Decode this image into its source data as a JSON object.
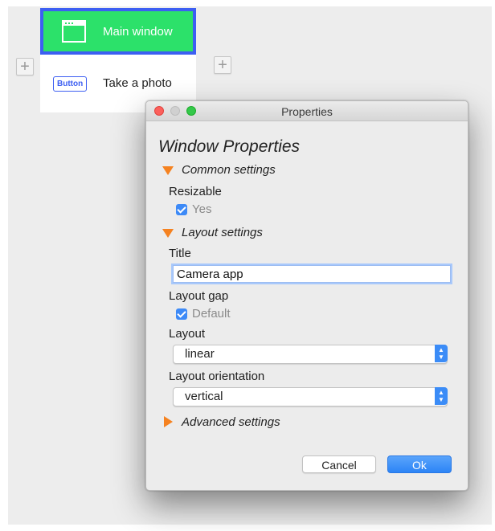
{
  "tree": {
    "main_window_label": "Main window",
    "button_badge": "Button",
    "button_label": "Take a photo",
    "add_icon": "+"
  },
  "dialog": {
    "title": "Properties",
    "heading": "Window Properties",
    "common_settings": {
      "label": "Common settings",
      "resizable_label": "Resizable",
      "resizable_checked": true,
      "resizable_option": "Yes"
    },
    "layout_settings": {
      "label": "Layout settings",
      "title_label": "Title",
      "title_value": "Camera app",
      "layout_gap_label": "Layout gap",
      "layout_gap_checked": true,
      "layout_gap_option": "Default",
      "layout_label": "Layout",
      "layout_value": "linear",
      "orientation_label": "Layout orientation",
      "orientation_value": "vertical"
    },
    "advanced_settings": {
      "label": "Advanced settings"
    },
    "buttons": {
      "cancel": "Cancel",
      "ok": "Ok"
    }
  },
  "colors": {
    "selection_green": "#2ce16a",
    "selection_border": "#3d5ff2",
    "disclosure_orange": "#f58220",
    "accent_blue": "#3b8cf7"
  },
  "icons": {
    "add": "plus-icon",
    "window": "window-icon",
    "disclosure_open": "triangle-down-icon",
    "disclosure_closed": "triangle-right-icon",
    "checkbox": "checkmark-icon",
    "stepper": "updown-arrows-icon"
  }
}
